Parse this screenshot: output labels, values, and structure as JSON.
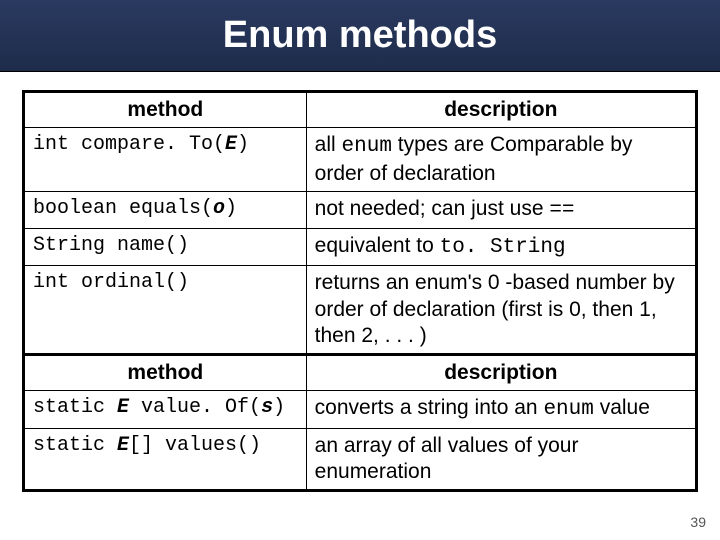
{
  "title": "Enum methods",
  "headers": {
    "method": "method",
    "description": "description"
  },
  "table1": [
    {
      "m_pre": "int compare. To(",
      "m_param": "E",
      "m_post": ")",
      "d_pre": "all ",
      "d_mono1": "enum",
      "d_mid": " types are Comparable by order of declaration",
      "d_mono2": "",
      "d_post": ""
    },
    {
      "m_pre": "boolean equals(",
      "m_param": "o",
      "m_post": ")",
      "d_pre": "not needed;  can just use ",
      "d_mono1": "==",
      "d_mid": "",
      "d_mono2": "",
      "d_post": ""
    },
    {
      "m_pre": "String name()",
      "m_param": "",
      "m_post": "",
      "d_pre": "equivalent to ",
      "d_mono1": "to. String",
      "d_mid": "",
      "d_mono2": "",
      "d_post": ""
    },
    {
      "m_pre": "int ordinal()",
      "m_param": "",
      "m_post": "",
      "d_pre": "returns an enum's 0 -based number by order of declaration  (first is 0, then 1, then 2, . . . )",
      "d_mono1": "",
      "d_mid": "",
      "d_mono2": "",
      "d_post": ""
    }
  ],
  "table2": [
    {
      "m_pre": "static ",
      "m_type": "E",
      "m_mid": " value. Of(",
      "m_param": "s",
      "m_post": ")",
      "d_pre": "converts a string into an ",
      "d_mono1": "enum",
      "d_mid": " value"
    },
    {
      "m_pre": "static ",
      "m_type": "E",
      "m_mid": "[] values()",
      "m_param": "",
      "m_post": "",
      "d_pre": "an array of all values of your enumeration",
      "d_mono1": "",
      "d_mid": ""
    }
  ],
  "page": "39"
}
